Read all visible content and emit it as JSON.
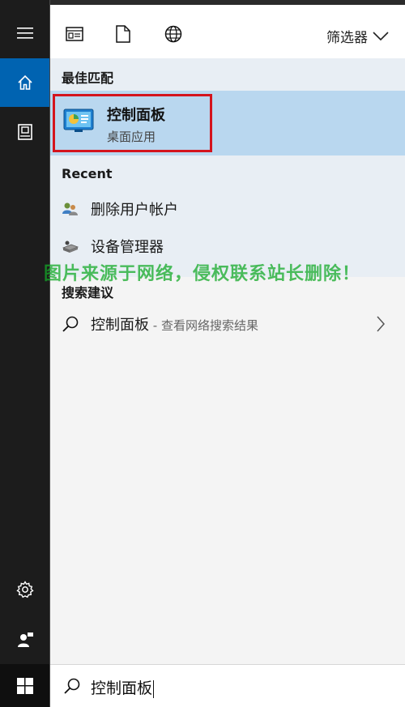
{
  "rail": {
    "items": [
      {
        "icon": "hamburger-menu-icon"
      },
      {
        "icon": "home-icon",
        "active": true
      },
      {
        "icon": "device-doc-icon"
      },
      {
        "icon": "settings-gear-icon"
      },
      {
        "icon": "user-feedback-icon"
      }
    ],
    "start_icon": "windows-logo-icon"
  },
  "toolbar": {
    "icons": [
      "apps-icon",
      "document-icon",
      "web-globe-icon"
    ],
    "filter_label": "筛选器"
  },
  "best_match": {
    "heading": "最佳匹配",
    "title": "控制面板",
    "subtitle": "桌面应用"
  },
  "recent": {
    "heading": "Recent",
    "items": [
      {
        "label": "删除用户帐户",
        "icon": "users-icon"
      },
      {
        "label": "设备管理器",
        "icon": "device-manager-icon"
      }
    ]
  },
  "suggestions": {
    "heading": "搜索建议",
    "items": [
      {
        "label": "控制面板",
        "hint": " - 查看网络搜索结果"
      }
    ]
  },
  "watermark": "图片来源于网络，侵权联系站长删除！",
  "search": {
    "value": "控制面板"
  },
  "colors": {
    "accent": "#0063b1",
    "selected_bg": "#b9d7ef",
    "highlight_border": "#d4141d",
    "rail_bg": "#1c1c1c"
  }
}
